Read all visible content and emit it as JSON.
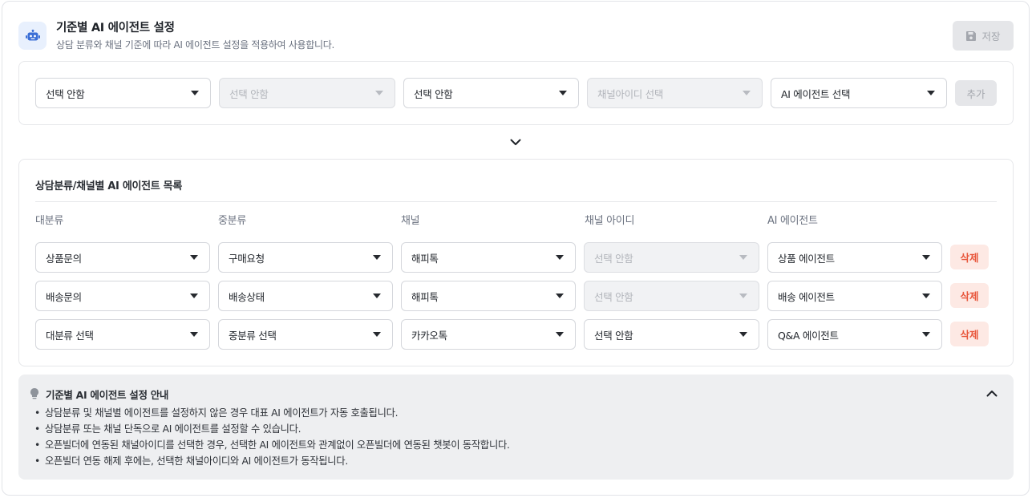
{
  "header": {
    "title": "기준별 AI 에이전트 설정",
    "subtitle": "상담 분류와 채널 기준에 따라 AI 에이전트 설정을 적용하여 사용합니다.",
    "icon": "robot-icon",
    "save_label": "저장",
    "save_icon": "floppy-disk-icon"
  },
  "add_row": {
    "major": "선택 안함",
    "middle": "선택 안함",
    "channel": "선택 안함",
    "channel_id": "채널아이디 선택",
    "agent": "AI 에이전트 선택",
    "add_label": "추가"
  },
  "list": {
    "title": "상담분류/채널별 AI 에이전트 목록",
    "columns": [
      "대분류",
      "중분류",
      "채널",
      "채널 아이디",
      "AI 에이전트"
    ],
    "rows": [
      {
        "major": "상품문의",
        "middle": "구매요청",
        "channel": "해피톡",
        "channel_id": "선택 안함",
        "agent": "상품 에이전트",
        "delete": "삭제"
      },
      {
        "major": "배송문의",
        "middle": "배송상태",
        "channel": "해피톡",
        "channel_id": "선택 안함",
        "agent": "배송 에이전트",
        "delete": "삭제"
      },
      {
        "major": "대분류 선택",
        "middle": "중분류 선택",
        "channel": "카카오톡",
        "channel_id": "선택 안함",
        "agent": "Q&A 에이전트",
        "delete": "삭제"
      }
    ]
  },
  "guide": {
    "title": "기준별 AI 에이전트 설정 안내",
    "icon": "lightbulb-icon",
    "items": [
      "상담분류 및 채널별 에이전트를 설정하지 않은 경우 대표 AI 에이전트가 자동 호출됩니다.",
      "상담분류 또는 채널 단독으로 AI 에이전트를 설정할 수 있습니다.",
      "오픈빌더에 연동된 채널아이디를 선택한 경우, 선택한 AI 에이전트와 관계없이 오픈빌더에 연동된 챗봇이 동작합니다.",
      "오픈빌더 연동 해제 후에는, 선택한 채널아이디와 AI 에이전트가 동작됩니다."
    ]
  },
  "colors": {
    "accent_light": "#e8f0fd",
    "delete_bg": "#fde9e4",
    "delete_text": "#e8553a",
    "disabled_bg": "#f1f2f4"
  }
}
